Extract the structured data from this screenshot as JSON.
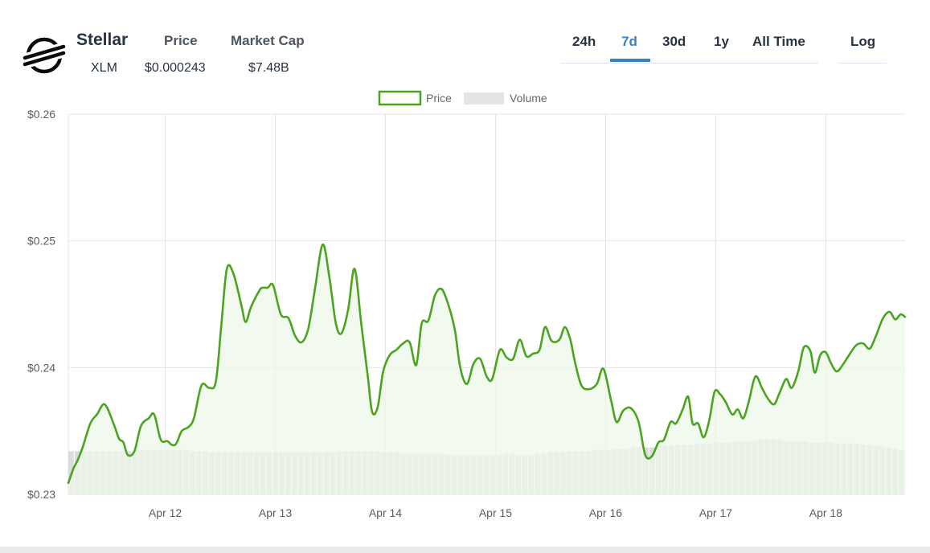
{
  "coin": {
    "name": "Stellar",
    "symbol": "XLM",
    "price_label": "Price",
    "price_value": "$0.000243",
    "market_cap_label": "Market Cap",
    "market_cap_value": "$7.48B"
  },
  "range_tabs": [
    {
      "label": "24h",
      "active": false
    },
    {
      "label": "7d",
      "active": true
    },
    {
      "label": "30d",
      "active": false
    },
    {
      "label": "1y",
      "active": false
    },
    {
      "label": "All Time",
      "active": false
    }
  ],
  "log_toggle": {
    "label": "Log"
  },
  "colors": {
    "price_line": "#4aa41f",
    "price_fill": "#eef7ea",
    "volume_bar": "#dadcdb",
    "accent": "#3782c2"
  },
  "chart_data": {
    "type": "line",
    "legend": [
      {
        "name": "Price",
        "color": "#4aa41f"
      },
      {
        "name": "Volume",
        "color": "#e4e4e4"
      }
    ],
    "legend_position": "top-center",
    "y_ticks": [
      "$0.26",
      "$0.25",
      "$0.24",
      "$0.23"
    ],
    "ylim": [
      0.23,
      0.26
    ],
    "x_ticks": [
      "Apr 12",
      "Apr 13",
      "Apr 14",
      "Apr 15",
      "Apr 16",
      "Apr 17",
      "Apr 18"
    ],
    "x_tick_positions": [
      12,
      13,
      14,
      15,
      16,
      17,
      18
    ],
    "xlim": [
      11.12,
      18.72
    ],
    "grid": true,
    "series": [
      {
        "name": "Price",
        "x": [
          11.12,
          11.17,
          11.2,
          11.25,
          11.32,
          11.38,
          11.45,
          11.53,
          11.58,
          11.62,
          11.66,
          11.72,
          11.78,
          11.85,
          11.9,
          11.96,
          12.02,
          12.06,
          12.1,
          12.15,
          12.21,
          12.26,
          12.33,
          12.4,
          12.46,
          12.51,
          12.56,
          12.62,
          12.69,
          12.73,
          12.78,
          12.85,
          12.88,
          12.93,
          12.98,
          13.05,
          13.12,
          13.18,
          13.24,
          13.3,
          13.36,
          13.43,
          13.49,
          13.55,
          13.6,
          13.66,
          13.72,
          13.78,
          13.84,
          13.88,
          13.93,
          13.98,
          14.04,
          14.1,
          14.16,
          14.22,
          14.28,
          14.33,
          14.39,
          14.45,
          14.51,
          14.57,
          14.63,
          14.68,
          14.74,
          14.8,
          14.86,
          14.92,
          14.97,
          15.04,
          15.1,
          15.16,
          15.22,
          15.28,
          15.34,
          15.4,
          15.45,
          15.51,
          15.58,
          15.63,
          15.68,
          15.72,
          15.78,
          15.85,
          15.92,
          15.98,
          16.05,
          16.1,
          16.16,
          16.23,
          16.3,
          16.36,
          16.42,
          16.48,
          16.53,
          16.59,
          16.64,
          16.7,
          16.75,
          16.79,
          16.84,
          16.89,
          16.94,
          16.99,
          17.04,
          17.09,
          17.15,
          17.2,
          17.25,
          17.3,
          17.36,
          17.42,
          17.47,
          17.53,
          17.58,
          17.64,
          17.69,
          17.75,
          17.8,
          17.86,
          17.9,
          17.95,
          18.0,
          18.05,
          18.1,
          18.16,
          18.22,
          18.28,
          18.34,
          18.4,
          18.46,
          18.52,
          18.58,
          18.63,
          18.68,
          18.72
        ],
        "values": [
          0.2309,
          0.2321,
          0.2326,
          0.2337,
          0.2356,
          0.2363,
          0.2371,
          0.2356,
          0.2344,
          0.2341,
          0.2331,
          0.2334,
          0.2354,
          0.236,
          0.2363,
          0.2343,
          0.2342,
          0.2339,
          0.234,
          0.235,
          0.2353,
          0.236,
          0.2386,
          0.2384,
          0.2389,
          0.2434,
          0.2478,
          0.2474,
          0.245,
          0.2436,
          0.2448,
          0.246,
          0.2463,
          0.2463,
          0.2465,
          0.2442,
          0.2439,
          0.2425,
          0.242,
          0.2431,
          0.2462,
          0.2497,
          0.2472,
          0.2435,
          0.2427,
          0.2445,
          0.2478,
          0.2435,
          0.2393,
          0.2365,
          0.2369,
          0.2397,
          0.241,
          0.2414,
          0.2419,
          0.242,
          0.2402,
          0.2435,
          0.2437,
          0.2457,
          0.2462,
          0.245,
          0.243,
          0.24,
          0.2387,
          0.2403,
          0.2407,
          0.2393,
          0.2391,
          0.2414,
          0.2408,
          0.2407,
          0.2422,
          0.2409,
          0.2411,
          0.2414,
          0.2432,
          0.2421,
          0.2422,
          0.2432,
          0.2422,
          0.2405,
          0.2386,
          0.2383,
          0.2387,
          0.2399,
          0.2374,
          0.2357,
          0.2366,
          0.2368,
          0.2357,
          0.2331,
          0.233,
          0.2341,
          0.2343,
          0.2357,
          0.2356,
          0.2367,
          0.2377,
          0.2356,
          0.2356,
          0.2345,
          0.2358,
          0.2381,
          0.2379,
          0.2373,
          0.2363,
          0.2367,
          0.236,
          0.2373,
          0.2393,
          0.2384,
          0.2376,
          0.2371,
          0.238,
          0.2391,
          0.2384,
          0.2397,
          0.2416,
          0.2413,
          0.2396,
          0.241,
          0.2412,
          0.2403,
          0.2397,
          0.2403,
          0.2411,
          0.2418,
          0.2419,
          0.2415,
          0.2426,
          0.2439,
          0.2444,
          0.2438,
          0.2442,
          0.244
        ]
      },
      {
        "name": "Volume",
        "relative": true,
        "values": [
          0.0034,
          0.0034,
          0.0034,
          0.0034,
          0.0034,
          0.0034,
          0.0034,
          0.0034,
          0.0034,
          0.0034,
          0.0034,
          0.0035,
          0.0035,
          0.0035,
          0.0035,
          0.0035,
          0.0035,
          0.0035,
          0.0035,
          0.0034,
          0.0034,
          0.0034,
          0.0033,
          0.0033,
          0.0033,
          0.0033,
          0.0033,
          0.0033,
          0.0033,
          0.0033,
          0.0033,
          0.0033,
          0.0033,
          0.0033,
          0.0033,
          0.0033,
          0.0033,
          0.0033,
          0.0033,
          0.0033,
          0.0033,
          0.0033,
          0.0034,
          0.0034,
          0.0034,
          0.0034,
          0.0034,
          0.0034,
          0.0034,
          0.0033,
          0.0033,
          0.0033,
          0.0032,
          0.0032,
          0.0032,
          0.0032,
          0.0032,
          0.0032,
          0.0032,
          0.0031,
          0.0031,
          0.0031,
          0.0031,
          0.0031,
          0.0031,
          0.0031,
          0.0031,
          0.0031,
          0.0032,
          0.0032,
          0.0031,
          0.0031,
          0.0031,
          0.0032,
          0.0032,
          0.0033,
          0.0033,
          0.0033,
          0.0034,
          0.0034,
          0.0034,
          0.0034,
          0.0035,
          0.0035,
          0.0035,
          0.0036,
          0.0036,
          0.0036,
          0.0037,
          0.0037,
          0.0037,
          0.0037,
          0.0038,
          0.0038,
          0.0038,
          0.0039,
          0.0039,
          0.0039,
          0.004,
          0.004,
          0.004,
          0.0041,
          0.0041,
          0.0041,
          0.0042,
          0.0042,
          0.0042,
          0.0042,
          0.0043,
          0.0043,
          0.0043,
          0.0043,
          0.0042,
          0.0042,
          0.0042,
          0.0042,
          0.0041,
          0.0041,
          0.0041,
          0.0041,
          0.004,
          0.004,
          0.004,
          0.004,
          0.0039,
          0.0039,
          0.0038,
          0.0038,
          0.0037,
          0.0036,
          0.0035
        ]
      }
    ]
  }
}
